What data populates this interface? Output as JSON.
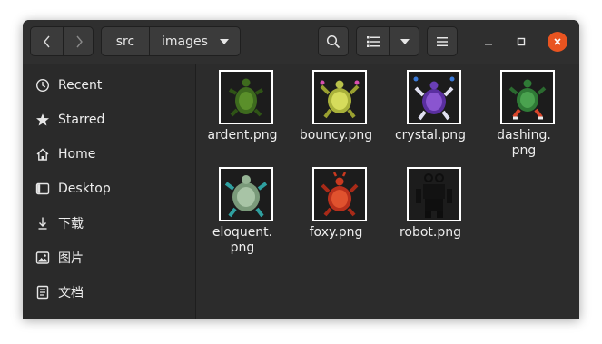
{
  "headerbar": {
    "path": [
      "src",
      "images"
    ]
  },
  "sidebar": {
    "items": [
      {
        "label": "Recent",
        "icon": "clock-icon"
      },
      {
        "label": "Starred",
        "icon": "star-icon"
      },
      {
        "label": "Home",
        "icon": "home-icon"
      },
      {
        "label": "Desktop",
        "icon": "desktop-icon"
      },
      {
        "label": "下载",
        "icon": "download-icon"
      },
      {
        "label": "图片",
        "icon": "pictures-icon"
      },
      {
        "label": "文档",
        "icon": "documents-icon"
      }
    ]
  },
  "files": [
    {
      "name": "ardent.png",
      "name_line1": "ardent.png",
      "name_line2": ""
    },
    {
      "name": "bouncy.png",
      "name_line1": "bouncy.png",
      "name_line2": ""
    },
    {
      "name": "crystal.png",
      "name_line1": "crystal.png",
      "name_line2": ""
    },
    {
      "name": "dashing.png",
      "name_line1": "dashing.",
      "name_line2": "png"
    },
    {
      "name": "eloquent.png",
      "name_line1": "eloquent.",
      "name_line2": "png"
    },
    {
      "name": "foxy.png",
      "name_line1": "foxy.png",
      "name_line2": ""
    },
    {
      "name": "robot.png",
      "name_line1": "robot.png",
      "name_line2": ""
    }
  ],
  "colors": {
    "accent_close": "#e95420",
    "window_bg": "#2c2c2c"
  }
}
